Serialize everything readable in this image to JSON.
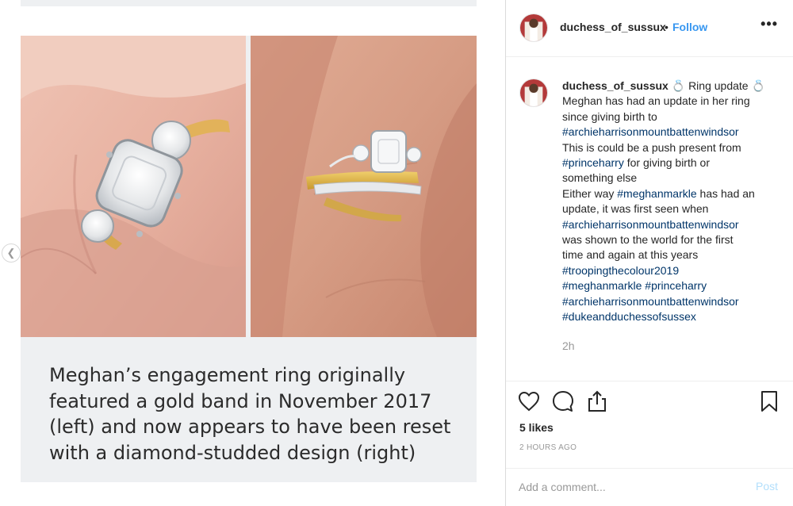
{
  "post": {
    "caption": [
      "Meghan’s engagement ring originally",
      "featured a gold band in November 2017",
      "(left) and now appears to have been reset",
      "with a diamond-studded design (right)"
    ]
  },
  "header": {
    "username": "duchess_of_sussux",
    "separator": "•",
    "follow_label": "Follow",
    "more_label": "•••"
  },
  "comment": {
    "username": "duchess_of_sussux",
    "ring_emoji": "💍",
    "first_line_rest": "Ring update",
    "lines": [
      {
        "text": "Meghan has had an update in her ring",
        "tag": false
      },
      {
        "text": "since giving birth to",
        "tag": false
      },
      {
        "text": "#archieharrisonmountbattenwindsor",
        "tag": true
      },
      {
        "text": "This is could be a push present from",
        "tag": false
      }
    ],
    "line_princeharry_tag": "#princeharry",
    "line_princeharry_rest": " for giving birth or",
    "line_something": "something else",
    "line_either_pre": "Either way ",
    "line_either_tag": "#meghanmarkle",
    "line_either_rest": " has had an",
    "line_update": "update, it was first seen when",
    "line_archie2": "#archieharrisonmountbattenwindsor",
    "line_shown": "was shown to the world for the first",
    "line_time": "time and again at this years",
    "line_trooping": "#troopingthecolour2019",
    "line_tags_a": "#meghanmarkle",
    "line_tags_b": "#princeharry",
    "line_archie3": "#archieharrisonmountbattenwindsor",
    "line_duke": "#dukeandduchessofsussex",
    "time_ago": "2h"
  },
  "actions": {
    "likes": "5 likes",
    "posted_ago": "2 HOURS AGO"
  },
  "add_comment": {
    "placeholder": "Add a comment...",
    "post_label": "Post"
  },
  "colors": {
    "link_blue": "#3897f0",
    "hashtag": "#003569",
    "muted": "#999999",
    "post_disabled": "#b2dffc"
  },
  "icons": [
    "chevron-left-icon",
    "heart-icon",
    "comment-bubble-icon",
    "share-icon",
    "bookmark-icon",
    "more-options-icon"
  ]
}
